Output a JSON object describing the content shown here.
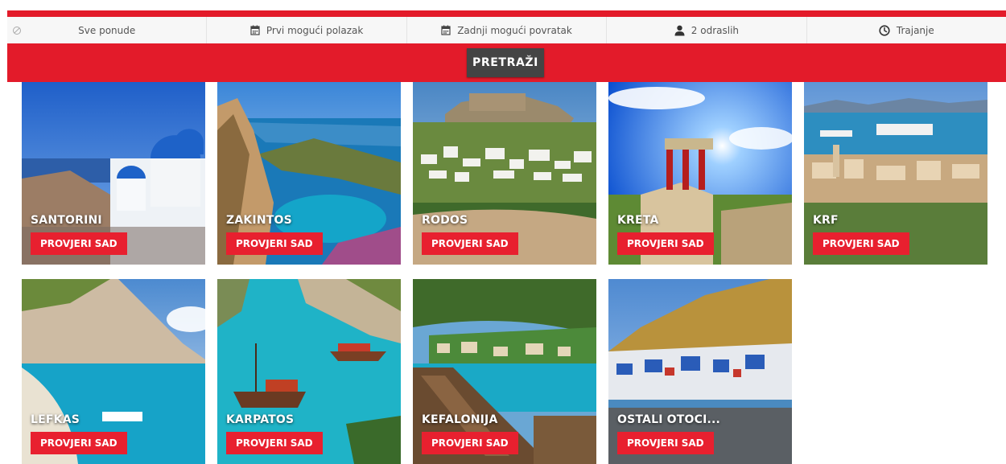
{
  "search": {
    "offers": "Sve ponude",
    "departure": "Prvi mogući polazak",
    "return": "Zadnji mogući povratak",
    "guests": "2 odraslih",
    "duration": "Trajanje",
    "button": "PRETRAŽI"
  },
  "colors": {
    "brand": "#e31b2a",
    "button_dark": "#444444",
    "card_button": "#e8202f"
  },
  "destinations": [
    {
      "name": "SANTORINI",
      "cta": "PROVJERI SAD"
    },
    {
      "name": "ZAKINTOS",
      "cta": "PROVJERI SAD"
    },
    {
      "name": "RODOS",
      "cta": "PROVJERI SAD"
    },
    {
      "name": "KRETA",
      "cta": "PROVJERI SAD"
    },
    {
      "name": "KRF",
      "cta": "PROVJERI SAD"
    },
    {
      "name": "LEFKAS",
      "cta": "PROVJERI SAD"
    },
    {
      "name": "KARPATOS",
      "cta": "PROVJERI SAD"
    },
    {
      "name": "KEFALONIJA",
      "cta": "PROVJERI SAD"
    },
    {
      "name": "OSTALI OTOCI...",
      "cta": "PROVJERI SAD"
    }
  ]
}
